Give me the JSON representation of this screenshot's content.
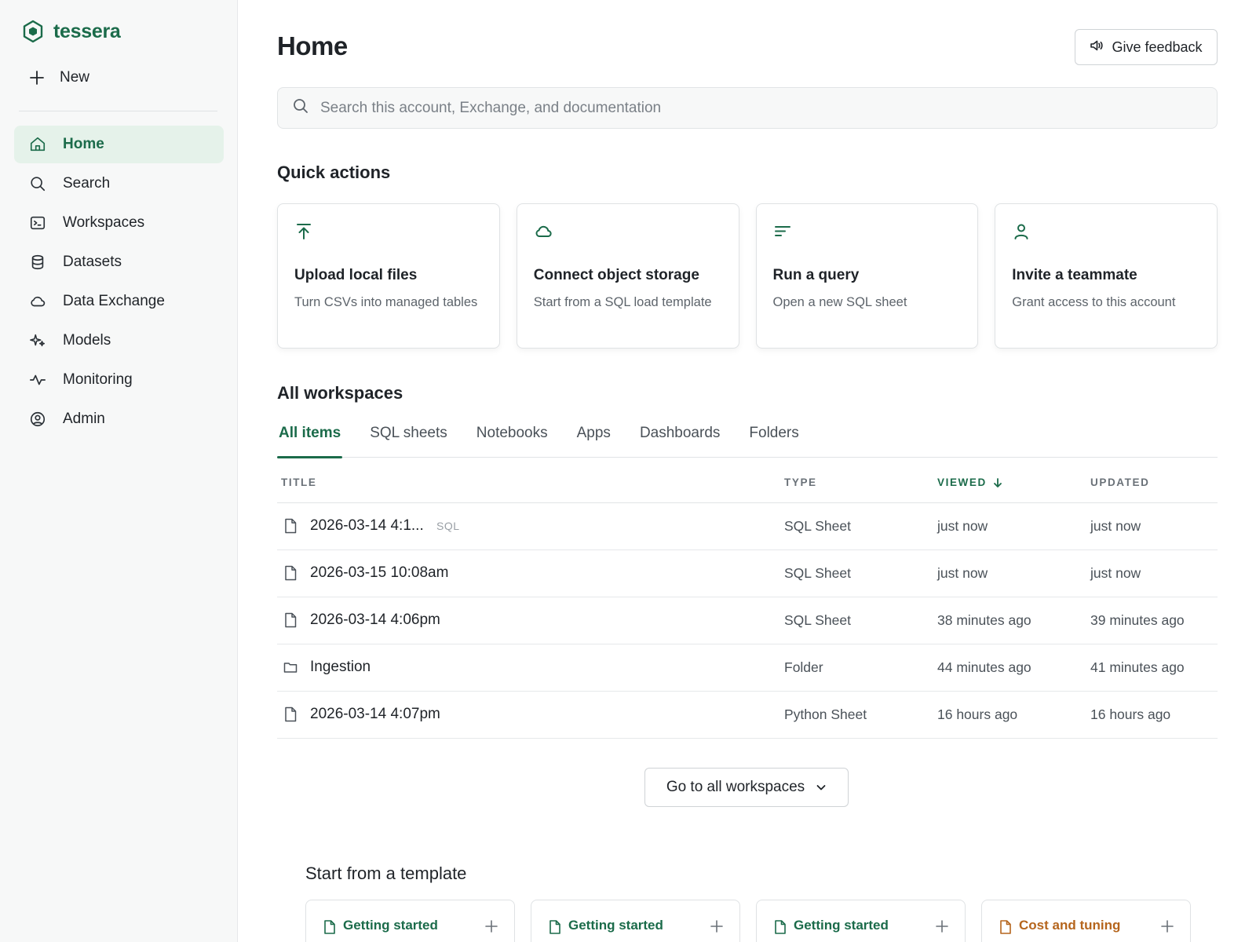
{
  "app": {
    "name": "tessera"
  },
  "sidebar": {
    "new_label": "New",
    "items": [
      {
        "label": "Home",
        "icon": "home-icon",
        "active": true
      },
      {
        "label": "Search",
        "icon": "search-icon"
      },
      {
        "label": "Workspaces",
        "icon": "terminal-icon"
      },
      {
        "label": "Datasets",
        "icon": "database-icon"
      },
      {
        "label": "Data Exchange",
        "icon": "cloud-icon"
      },
      {
        "label": "Models",
        "icon": "sparkles-icon"
      },
      {
        "label": "Monitoring",
        "icon": "activity-icon"
      },
      {
        "label": "Admin",
        "icon": "user-circle-icon"
      }
    ]
  },
  "header": {
    "title": "Home",
    "feedback_label": "Give feedback"
  },
  "search": {
    "placeholder": "Search this account, Exchange, and documentation"
  },
  "quick_actions": {
    "heading": "Quick actions",
    "cards": [
      {
        "title": "Upload local files",
        "desc": "Turn CSVs into managed tables",
        "icon": "upload-icon"
      },
      {
        "title": "Connect object storage",
        "desc": "Start from a SQL load template",
        "icon": "cloud-icon"
      },
      {
        "title": "Run a query",
        "desc": "Open a new SQL sheet",
        "icon": "lines-icon"
      },
      {
        "title": "Invite a teammate",
        "desc": "Grant access to this account",
        "icon": "user-icon"
      }
    ]
  },
  "workspaces": {
    "heading": "All workspaces",
    "tabs": [
      "All items",
      "SQL sheets",
      "Notebooks",
      "Apps",
      "Dashboards",
      "Folders"
    ],
    "active_tab": "All items",
    "columns": {
      "title": "TITLE",
      "type": "TYPE",
      "viewed": "VIEWED",
      "updated": "UPDATED"
    },
    "rows": [
      {
        "title": "2026-03-14 4:1...",
        "tag": "SQL",
        "type": "SQL Sheet",
        "viewed": "just now",
        "updated": "just now",
        "icon": "file-icon"
      },
      {
        "title": "2026-03-15 10:08am",
        "tag": "",
        "type": "SQL Sheet",
        "viewed": "just now",
        "updated": "just now",
        "icon": "file-icon"
      },
      {
        "title": "2026-03-14 4:06pm",
        "tag": "",
        "type": "SQL Sheet",
        "viewed": "38 minutes ago",
        "updated": "39 minutes ago",
        "icon": "file-icon"
      },
      {
        "title": "Ingestion",
        "tag": "",
        "type": "Folder",
        "viewed": "44 minutes ago",
        "updated": "41 minutes ago",
        "icon": "folder-icon"
      },
      {
        "title": "2026-03-14 4:07pm",
        "tag": "",
        "type": "Python Sheet",
        "viewed": "16 hours ago",
        "updated": "16 hours ago",
        "icon": "file-icon"
      }
    ],
    "go_all_label": "Go to all workspaces"
  },
  "templates": {
    "heading": "Start from a template",
    "cards": [
      {
        "label": "Getting started",
        "color": "#1b6b4a"
      },
      {
        "label": "Getting started",
        "color": "#1b6b4a"
      },
      {
        "label": "Getting started",
        "color": "#1b6b4a"
      },
      {
        "label": "Cost and tuning",
        "color": "#b5651d"
      }
    ]
  },
  "colors": {
    "accent": "#1b6b4a",
    "active_bg": "#e5f2ea",
    "orange": "#b5651d"
  }
}
